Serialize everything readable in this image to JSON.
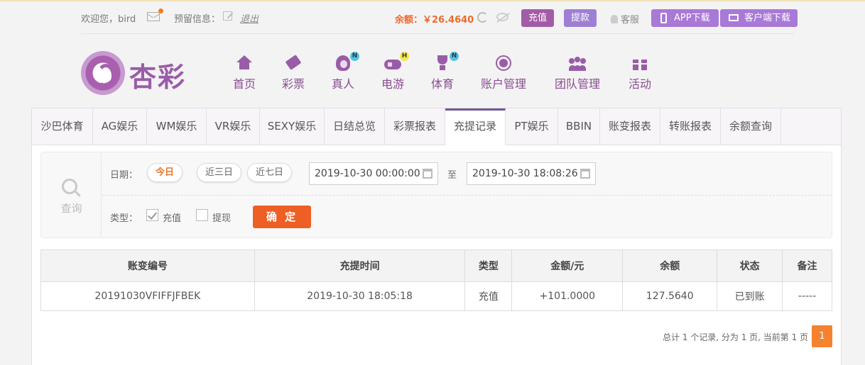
{
  "topbar": {
    "welcome": "欢迎您，bird",
    "reserved": "预留信息：",
    "logout": "退出",
    "balance": "余额：￥26.4640",
    "recharge": "充值",
    "withdraw": "提款",
    "service": "客服",
    "app_download": "APP下载",
    "client_download": "客户端下载"
  },
  "logo": {
    "text": "杏彩"
  },
  "nav": [
    {
      "label": "首页",
      "icon": "home-icon"
    },
    {
      "label": "彩票",
      "icon": "ticket-icon"
    },
    {
      "label": "真人",
      "icon": "live-dealer-icon",
      "badge": "N"
    },
    {
      "label": "电游",
      "icon": "gamepad-icon",
      "badge": "H"
    },
    {
      "label": "体育",
      "icon": "trophy-icon",
      "badge": "N"
    },
    {
      "label": "账户管理",
      "icon": "yen-icon"
    },
    {
      "label": "团队管理",
      "icon": "team-icon"
    },
    {
      "label": "活动",
      "icon": "gift-icon"
    }
  ],
  "tabs": [
    "沙巴体育",
    "AG娱乐",
    "WM娱乐",
    "VR娱乐",
    "SEXY娱乐",
    "日结总览",
    "彩票报表",
    "充提记录",
    "PT娱乐",
    "BBIN",
    "账变报表",
    "转账报表",
    "余额查询"
  ],
  "active_tab": "充提记录",
  "query": {
    "title": "查询",
    "date_label": "日期：",
    "ranges": [
      "今日",
      "近三日",
      "近七日"
    ],
    "active_range": "今日",
    "start": "2019-10-30 00:00:00",
    "to": "至",
    "end": "2019-10-30 18:08:26",
    "type_label": "类型：",
    "type_recharge": "充值",
    "type_recharge_checked": true,
    "type_withdraw": "提现",
    "type_withdraw_checked": false,
    "confirm": "确 定"
  },
  "table": {
    "headers": [
      "账变编号",
      "充提时间",
      "类型",
      "金额/元",
      "余额",
      "状态",
      "备注"
    ],
    "rows": [
      [
        "20191030VFIFFJFBEK",
        "2019-10-30 18:05:18",
        "充值",
        "+101.0000",
        "127.5640",
        "已到账",
        "-----"
      ]
    ]
  },
  "pager": {
    "info": "总计 1 个记录, 分为 1 页, 当前第 1 页",
    "current": "1"
  },
  "colors": {
    "brand": "#9a5ca8",
    "accent": "#ee5f25",
    "positive_amount": "#d9263a",
    "status_ok": "#37a33a"
  }
}
